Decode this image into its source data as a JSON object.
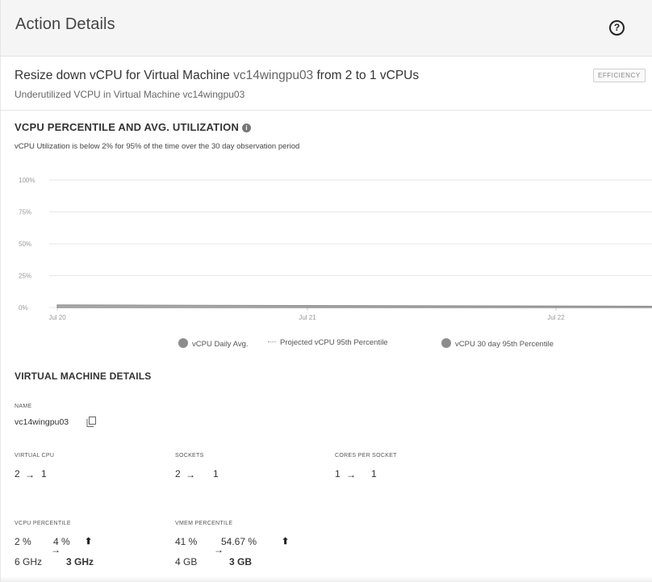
{
  "header": {
    "title": "Action Details",
    "help_icon": "help-circle-icon"
  },
  "action": {
    "title_prefix": "Resize down vCPU for Virtual Machine ",
    "vm_name": "vc14wingpu03",
    "title_suffix": " from 2 to 1 vCPUs",
    "subtitle": "Underutilized VCPU in Virtual Machine vc14wingpu03",
    "badge": "EFFICIENCY"
  },
  "chart_section": {
    "title": "VCPU PERCENTILE AND AVG. UTILIZATION",
    "info_icon": "info-icon",
    "description": "vCPU Utilization is below 2% for 95% of the time over the 30 day observation period"
  },
  "chart_data": {
    "type": "area",
    "categories": [
      "Jul 20",
      "Jul 21",
      "Jul 22"
    ],
    "y_ticks": [
      "100%",
      "75%",
      "50%",
      "25%",
      "0%"
    ],
    "ylim": [
      0,
      100
    ],
    "grid": true,
    "legend_placement": "bottom",
    "series": [
      {
        "name": "vCPU Daily Avg.",
        "values": [
          2,
          1.5,
          1
        ],
        "color": "#8c8c8c"
      },
      {
        "name": "Projected vCPU 95th Percentile",
        "values": [],
        "color": "#999999"
      },
      {
        "name": "vCPU 30 day 95th Percentile",
        "values": [],
        "color": "#8c8c8c"
      }
    ]
  },
  "vm_details": {
    "title": "VIRTUAL MACHINE DETAILS",
    "name_label": "NAME",
    "name_value": "vc14wingpu03",
    "copy_icon": "copy-icon",
    "virtual_cpu": {
      "label": "VIRTUAL CPU",
      "from": "2",
      "to": "1"
    },
    "sockets": {
      "label": "SOCKETS",
      "from": "2",
      "to": "1"
    },
    "cores_per_socket": {
      "label": "CORES PER SOCKET",
      "from": "1",
      "to": "1"
    },
    "vcpu_percentile": {
      "label": "VCPU PERCENTILE",
      "from_pct": "2 %",
      "to_pct": "4 %",
      "from_cap": "6 GHz",
      "to_cap": "3 GHz"
    },
    "vmem_percentile": {
      "label": "VMEM PERCENTILE",
      "from_pct": "41 %",
      "to_pct": "54.67 %",
      "from_cap": "4 GB",
      "to_cap": "3 GB"
    },
    "arrow_glyph": "→",
    "up_glyph": "⬆"
  }
}
